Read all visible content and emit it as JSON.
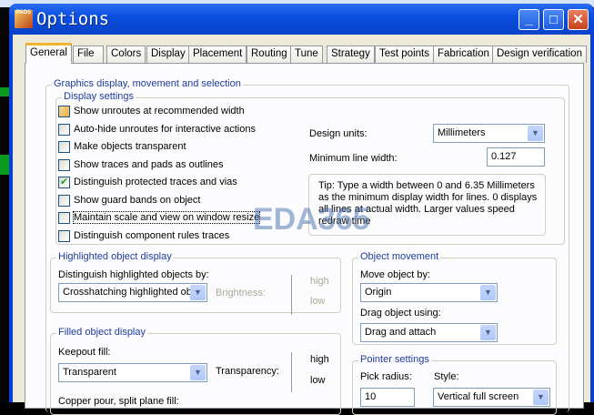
{
  "window": {
    "title": "Options",
    "app_icon": "PADS"
  },
  "tabs": [
    "General",
    "File",
    "Colors",
    "Display",
    "Placement",
    "Routing",
    "Tune",
    "Strategy",
    "Test points",
    "Fabrication",
    "Design verification"
  ],
  "active_tab": "General",
  "graphics_group": "Graphics display, movement and selection",
  "display_settings": {
    "label": "Display settings",
    "checkboxes": [
      {
        "label": "Show unroutes at recommended width",
        "checked": false
      },
      {
        "label": "Auto-hide unroutes for interactive actions",
        "checked": false
      },
      {
        "label": "Make objects transparent",
        "checked": false
      },
      {
        "label": "Show traces and pads as outlines",
        "checked": false
      },
      {
        "label": "Distinguish protected traces and vias",
        "checked": true
      },
      {
        "label": "Show guard bands on object",
        "checked": false
      },
      {
        "label": "Maintain scale and view on window resize",
        "checked": false
      },
      {
        "label": "Distinguish component rules traces",
        "checked": false
      }
    ],
    "design_units_label": "Design units:",
    "design_units": "Millimeters",
    "min_line_width_label": "Minimum line width:",
    "min_line_width": "0.127",
    "tip": "Tip: Type a width between 0 and 6.35 Millimeters as the minimum display width for lines. 0 displays all lines at actual width. Larger values speed redraw time"
  },
  "highlighted": {
    "label": "Highlighted object display",
    "by_label": "Distinguish highlighted objects by:",
    "by_value": "Crosshatching highlighted obj",
    "brightness_label": "Brightness:",
    "high": "high",
    "low": "low"
  },
  "filled": {
    "label": "Filled object display",
    "keepout_label": "Keepout fill:",
    "keepout_value": "Transparent",
    "transparency_label": "Transparency:",
    "high": "high",
    "low": "low",
    "copper_label": "Copper pour, split plane fill:"
  },
  "movement": {
    "label": "Object movement",
    "move_label": "Move object by:",
    "move_value": "Origin",
    "drag_label": "Drag object using:",
    "drag_value": "Drag and attach"
  },
  "pointer": {
    "label": "Pointer settings",
    "pick_label": "Pick radius:",
    "pick_value": "10",
    "style_label": "Style:",
    "style_value": "Vertical full screen"
  },
  "watermark": "EDA365"
}
